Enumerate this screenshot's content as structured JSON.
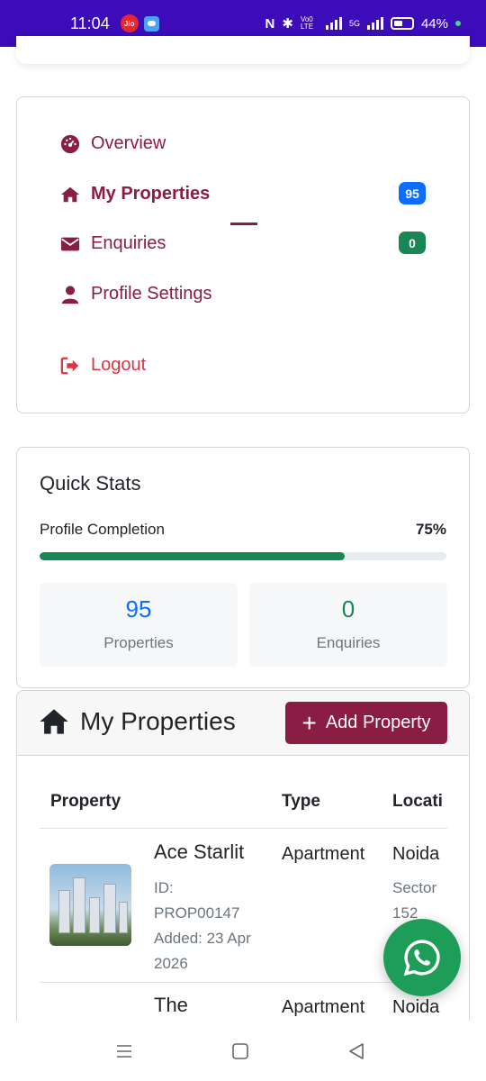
{
  "status_bar": {
    "time": "11:04",
    "carrier_icon_text": "Jio",
    "volte": "Vo0 LTE",
    "network": "5G",
    "battery": "44%"
  },
  "nav": {
    "items": [
      {
        "label": "Overview",
        "icon": "gauge-icon"
      },
      {
        "label": "My Properties",
        "icon": "home-icon",
        "badge": "95",
        "active": true
      },
      {
        "label": "Enquiries",
        "icon": "envelope-icon",
        "badge": "0"
      },
      {
        "label": "Profile Settings",
        "icon": "user-icon"
      },
      {
        "label": "Logout",
        "icon": "sign-out-icon"
      }
    ]
  },
  "quick_stats": {
    "title": "Quick Stats",
    "profile_label": "Profile Completion",
    "profile_value": "75%",
    "profile_fraction": 0.75,
    "properties_count": "95",
    "properties_label": "Properties",
    "enquiries_count": "0",
    "enquiries_label": "Enquiries"
  },
  "my_properties": {
    "title": "My Properties",
    "add_button": "Add Property",
    "columns": [
      "Property",
      "Type",
      "Locati"
    ],
    "rows": [
      {
        "name": "Ace Starlit",
        "id_label": "ID:",
        "id": "PROP00147",
        "added": "Added: 23 Apr",
        "added_year": "2026",
        "type": "Apartment",
        "city": "Noida",
        "sector": "Sector",
        "sector_no": "152"
      },
      {
        "name": "The",
        "type": "Apartment",
        "city": "Noida"
      }
    ]
  },
  "colors": {
    "brand": "#8a1d43",
    "status_bar": "#3b0cb8",
    "primary": "#0d6efd",
    "success": "#198754",
    "danger": "#dc3545",
    "whatsapp": "#1d9d57"
  }
}
